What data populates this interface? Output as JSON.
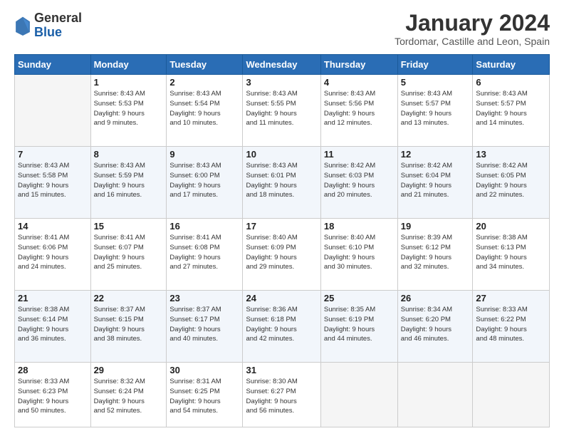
{
  "logo": {
    "general": "General",
    "blue": "Blue"
  },
  "header": {
    "month": "January 2024",
    "location": "Tordomar, Castille and Leon, Spain"
  },
  "weekdays": [
    "Sunday",
    "Monday",
    "Tuesday",
    "Wednesday",
    "Thursday",
    "Friday",
    "Saturday"
  ],
  "weeks": [
    [
      {
        "day": "",
        "info": ""
      },
      {
        "day": "1",
        "info": "Sunrise: 8:43 AM\nSunset: 5:53 PM\nDaylight: 9 hours\nand 9 minutes."
      },
      {
        "day": "2",
        "info": "Sunrise: 8:43 AM\nSunset: 5:54 PM\nDaylight: 9 hours\nand 10 minutes."
      },
      {
        "day": "3",
        "info": "Sunrise: 8:43 AM\nSunset: 5:55 PM\nDaylight: 9 hours\nand 11 minutes."
      },
      {
        "day": "4",
        "info": "Sunrise: 8:43 AM\nSunset: 5:56 PM\nDaylight: 9 hours\nand 12 minutes."
      },
      {
        "day": "5",
        "info": "Sunrise: 8:43 AM\nSunset: 5:57 PM\nDaylight: 9 hours\nand 13 minutes."
      },
      {
        "day": "6",
        "info": "Sunrise: 8:43 AM\nSunset: 5:57 PM\nDaylight: 9 hours\nand 14 minutes."
      }
    ],
    [
      {
        "day": "7",
        "info": "Sunrise: 8:43 AM\nSunset: 5:58 PM\nDaylight: 9 hours\nand 15 minutes."
      },
      {
        "day": "8",
        "info": "Sunrise: 8:43 AM\nSunset: 5:59 PM\nDaylight: 9 hours\nand 16 minutes."
      },
      {
        "day": "9",
        "info": "Sunrise: 8:43 AM\nSunset: 6:00 PM\nDaylight: 9 hours\nand 17 minutes."
      },
      {
        "day": "10",
        "info": "Sunrise: 8:43 AM\nSunset: 6:01 PM\nDaylight: 9 hours\nand 18 minutes."
      },
      {
        "day": "11",
        "info": "Sunrise: 8:42 AM\nSunset: 6:03 PM\nDaylight: 9 hours\nand 20 minutes."
      },
      {
        "day": "12",
        "info": "Sunrise: 8:42 AM\nSunset: 6:04 PM\nDaylight: 9 hours\nand 21 minutes."
      },
      {
        "day": "13",
        "info": "Sunrise: 8:42 AM\nSunset: 6:05 PM\nDaylight: 9 hours\nand 22 minutes."
      }
    ],
    [
      {
        "day": "14",
        "info": "Sunrise: 8:41 AM\nSunset: 6:06 PM\nDaylight: 9 hours\nand 24 minutes."
      },
      {
        "day": "15",
        "info": "Sunrise: 8:41 AM\nSunset: 6:07 PM\nDaylight: 9 hours\nand 25 minutes."
      },
      {
        "day": "16",
        "info": "Sunrise: 8:41 AM\nSunset: 6:08 PM\nDaylight: 9 hours\nand 27 minutes."
      },
      {
        "day": "17",
        "info": "Sunrise: 8:40 AM\nSunset: 6:09 PM\nDaylight: 9 hours\nand 29 minutes."
      },
      {
        "day": "18",
        "info": "Sunrise: 8:40 AM\nSunset: 6:10 PM\nDaylight: 9 hours\nand 30 minutes."
      },
      {
        "day": "19",
        "info": "Sunrise: 8:39 AM\nSunset: 6:12 PM\nDaylight: 9 hours\nand 32 minutes."
      },
      {
        "day": "20",
        "info": "Sunrise: 8:38 AM\nSunset: 6:13 PM\nDaylight: 9 hours\nand 34 minutes."
      }
    ],
    [
      {
        "day": "21",
        "info": "Sunrise: 8:38 AM\nSunset: 6:14 PM\nDaylight: 9 hours\nand 36 minutes."
      },
      {
        "day": "22",
        "info": "Sunrise: 8:37 AM\nSunset: 6:15 PM\nDaylight: 9 hours\nand 38 minutes."
      },
      {
        "day": "23",
        "info": "Sunrise: 8:37 AM\nSunset: 6:17 PM\nDaylight: 9 hours\nand 40 minutes."
      },
      {
        "day": "24",
        "info": "Sunrise: 8:36 AM\nSunset: 6:18 PM\nDaylight: 9 hours\nand 42 minutes."
      },
      {
        "day": "25",
        "info": "Sunrise: 8:35 AM\nSunset: 6:19 PM\nDaylight: 9 hours\nand 44 minutes."
      },
      {
        "day": "26",
        "info": "Sunrise: 8:34 AM\nSunset: 6:20 PM\nDaylight: 9 hours\nand 46 minutes."
      },
      {
        "day": "27",
        "info": "Sunrise: 8:33 AM\nSunset: 6:22 PM\nDaylight: 9 hours\nand 48 minutes."
      }
    ],
    [
      {
        "day": "28",
        "info": "Sunrise: 8:33 AM\nSunset: 6:23 PM\nDaylight: 9 hours\nand 50 minutes."
      },
      {
        "day": "29",
        "info": "Sunrise: 8:32 AM\nSunset: 6:24 PM\nDaylight: 9 hours\nand 52 minutes."
      },
      {
        "day": "30",
        "info": "Sunrise: 8:31 AM\nSunset: 6:25 PM\nDaylight: 9 hours\nand 54 minutes."
      },
      {
        "day": "31",
        "info": "Sunrise: 8:30 AM\nSunset: 6:27 PM\nDaylight: 9 hours\nand 56 minutes."
      },
      {
        "day": "",
        "info": ""
      },
      {
        "day": "",
        "info": ""
      },
      {
        "day": "",
        "info": ""
      }
    ]
  ]
}
